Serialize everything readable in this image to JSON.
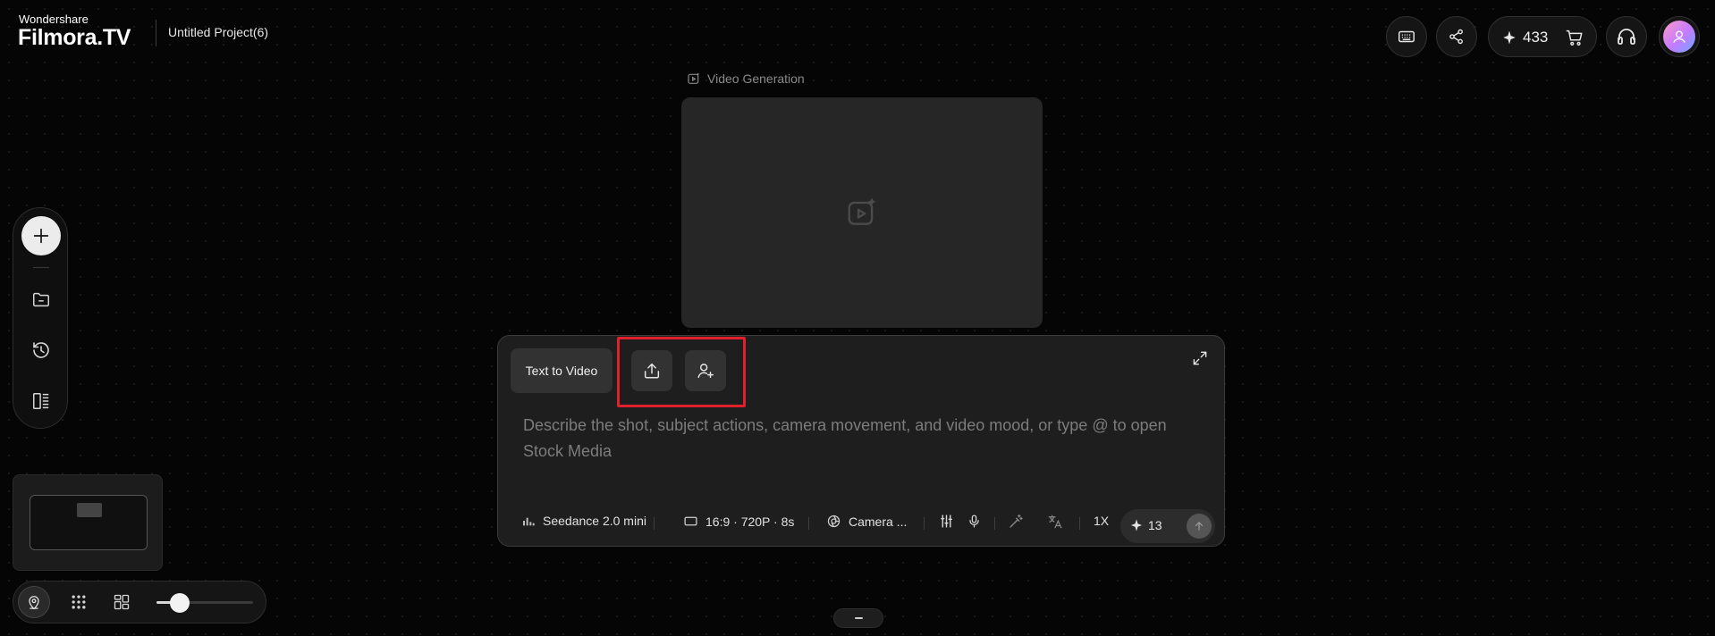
{
  "header": {
    "brand_small": "Wondershare",
    "brand_big": "Filmora.TV",
    "project_name": "Untitled Project(6)",
    "credits": "433",
    "icons": [
      "keyboard-icon",
      "share-icon",
      "sparkle-icon",
      "cart-icon",
      "headset-icon",
      "avatar"
    ]
  },
  "canvas": {
    "node_label": "Video Generation"
  },
  "left_toolbar": {
    "items": [
      "add-icon",
      "folder-icon",
      "history-icon",
      "layout-icon"
    ]
  },
  "prompt": {
    "mode": "Text to Video",
    "placeholder": "Describe the shot, subject actions, camera movement, and video mood, or type @ to open Stock Media",
    "model": "Seedance 2.0 mini",
    "format": "16:9 · 720P · 8s",
    "camera": "Camera ...",
    "speed": "1X",
    "cost": "13"
  },
  "bottom_controls": {
    "zoom_level": 0.2
  },
  "colors": {
    "background": "#050505",
    "panel": "#1e1e1e",
    "highlight": "#e0212d"
  }
}
